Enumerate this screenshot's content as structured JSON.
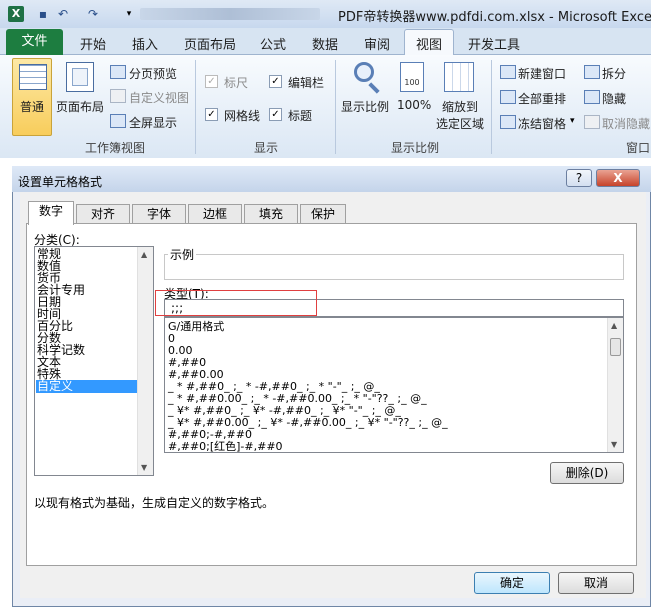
{
  "window": {
    "title": "PDF帝转换器www.pdfdi.com.xlsx  -  Microsoft Excel",
    "app_icon": "X"
  },
  "tabs": {
    "file": "文件",
    "items": [
      "开始",
      "插入",
      "页面布局",
      "公式",
      "数据",
      "审阅",
      "视图",
      "开发工具"
    ],
    "active": "视图"
  },
  "ribbon": {
    "workbook_views": {
      "normal": "普通",
      "page_layout": "页面布局",
      "page_break": "分页预览",
      "custom_views": "自定义视图",
      "full_screen": "全屏显示",
      "label": "工作簿视图"
    },
    "show": {
      "ruler": "标尺",
      "formula_bar": "编辑栏",
      "gridlines": "网格线",
      "headings": "标题",
      "label": "显示"
    },
    "zoom": {
      "zoom": "显示比例",
      "hundred": "100%",
      "hundred_icon": "100",
      "zoom_to_selection_1": "缩放到",
      "zoom_to_selection_2": "选定区域",
      "label": "显示比例"
    },
    "window": {
      "new_window": "新建窗口",
      "arrange_all": "全部重排",
      "freeze_panes": "冻结窗格",
      "split": "拆分",
      "hide": "隐藏",
      "unhide": "取消隐藏",
      "label": "窗口"
    }
  },
  "dialog": {
    "title": "设置单元格格式",
    "help_label": "?",
    "close_label": "X",
    "tabs": [
      "数字",
      "对齐",
      "字体",
      "边框",
      "填充",
      "保护"
    ],
    "category_label": "分类(C):",
    "categories": [
      "常规",
      "数值",
      "货币",
      "会计专用",
      "日期",
      "时间",
      "百分比",
      "分数",
      "科学记数",
      "文本",
      "特殊",
      "自定义"
    ],
    "selected_category": "自定义",
    "sample_label": "示例",
    "type_label": "类型(T):",
    "type_value": ";;;",
    "formats": [
      "G/通用格式",
      "0",
      "0.00",
      "#,##0",
      "#,##0.00",
      "_ * #,##0_ ;_ * -#,##0_ ;_ * \"-\"_ ;_ @_",
      "_ * #,##0.00_ ;_ * -#,##0.00_ ;_ * \"-\"??_ ;_ @_",
      "_ ¥* #,##0_ ;_ ¥* -#,##0_ ;_ ¥* \"-\"_ ;_ @_",
      "_ ¥* #,##0.00_ ;_ ¥* -#,##0.00_ ;_ ¥* \"-\"??_ ;_ @_",
      "#,##0;-#,##0",
      "#,##0;[红色]-#,##0"
    ],
    "delete_label": "删除(D)",
    "description": "以现有格式为基础，生成自定义的数字格式。",
    "ok_label": "确定",
    "cancel_label": "取消"
  },
  "colors": {
    "file_tab": "#1d7d40",
    "selection": "#3399ff",
    "highlight_box": "#e04040"
  }
}
